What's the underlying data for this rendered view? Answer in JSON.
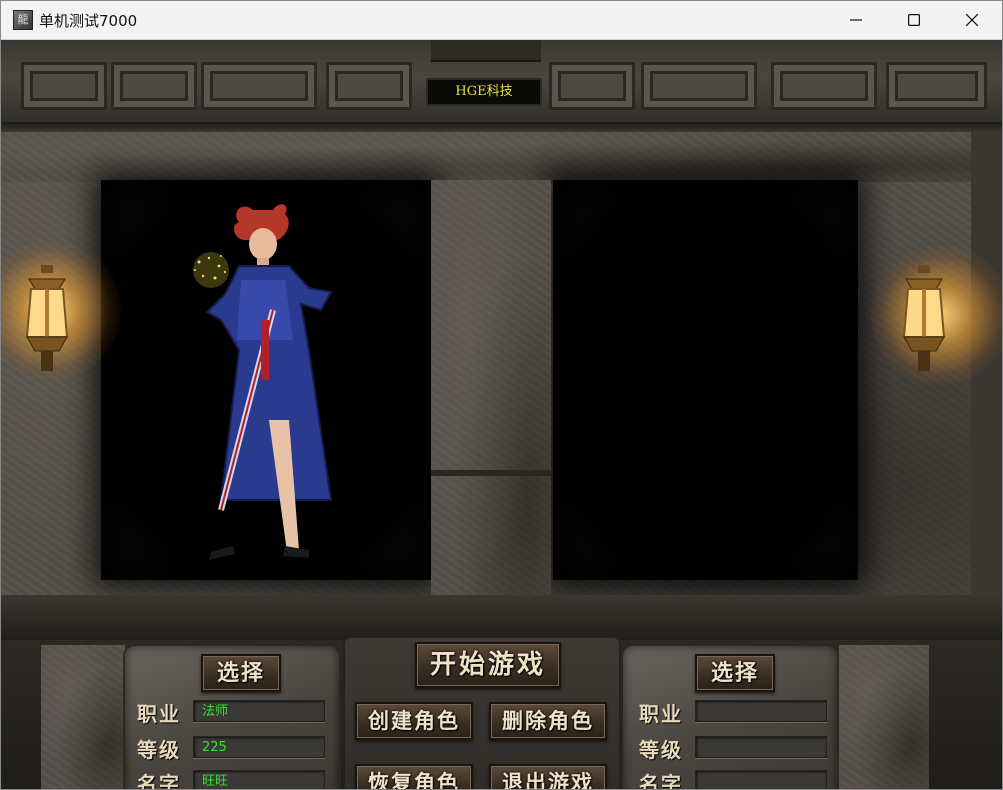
{
  "window": {
    "title": "单机测试7000",
    "icon_glyph": "龍"
  },
  "scene": {
    "plaque_text": "HGE科技"
  },
  "left_slot": {
    "select_label": "选择",
    "job_label": "职业",
    "level_label": "等级",
    "name_label": "名字",
    "job_value": "法师",
    "level_value": "225",
    "name_value": "旺旺"
  },
  "right_slot": {
    "select_label": "选择",
    "job_label": "职业",
    "level_label": "等级",
    "name_label": "名字",
    "job_value": "",
    "level_value": "",
    "name_value": ""
  },
  "actions": {
    "start_game": "开始游戏",
    "create_role": "创建角色",
    "delete_role": "删除角色",
    "restore_role": "恢复角色",
    "exit_game": "退出游戏"
  },
  "colors": {
    "field_text": "#34e234",
    "plaque_text": "#e8e23a",
    "button_text": "#f0e2c8"
  }
}
